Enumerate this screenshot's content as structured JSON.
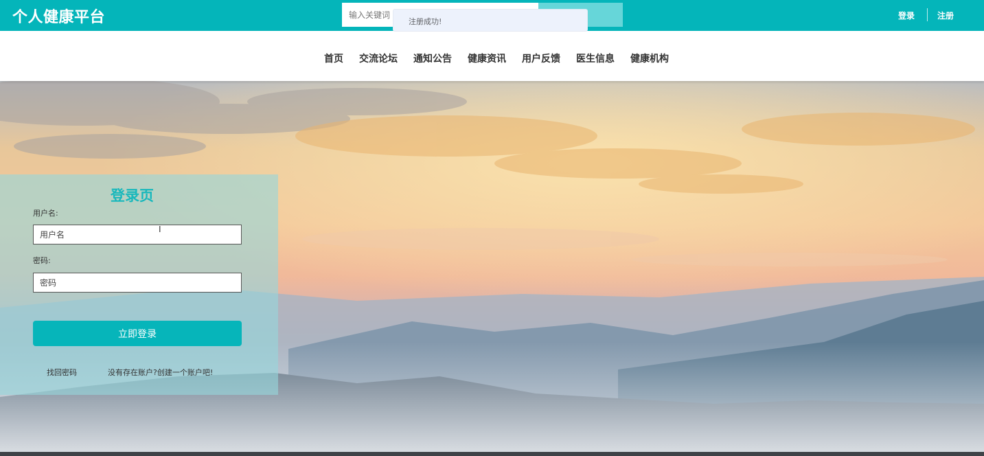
{
  "header": {
    "brand": "个人健康平台",
    "search_placeholder": "输入关键词",
    "toast_message": "注册成功!",
    "login_label": "登录",
    "register_label": "注册"
  },
  "nav": {
    "items": [
      "首页",
      "交流论坛",
      "通知公告",
      "健康资讯",
      "用户反馈",
      "医生信息",
      "健康机构"
    ]
  },
  "login": {
    "title": "登录页",
    "username_label": "用户名:",
    "username_placeholder": "用户名",
    "password_label": "密码:",
    "password_placeholder": "密码",
    "submit_label": "立即登录",
    "forgot_label": "找回密码",
    "register_link_label": "没有存在账户?创建一个账户吧!"
  },
  "colors": {
    "accent": "#04b5ba",
    "search_button": "#66d6d9",
    "nav_text": "#333333"
  },
  "icons": {
    "text_cursor": "text-cursor-icon"
  }
}
